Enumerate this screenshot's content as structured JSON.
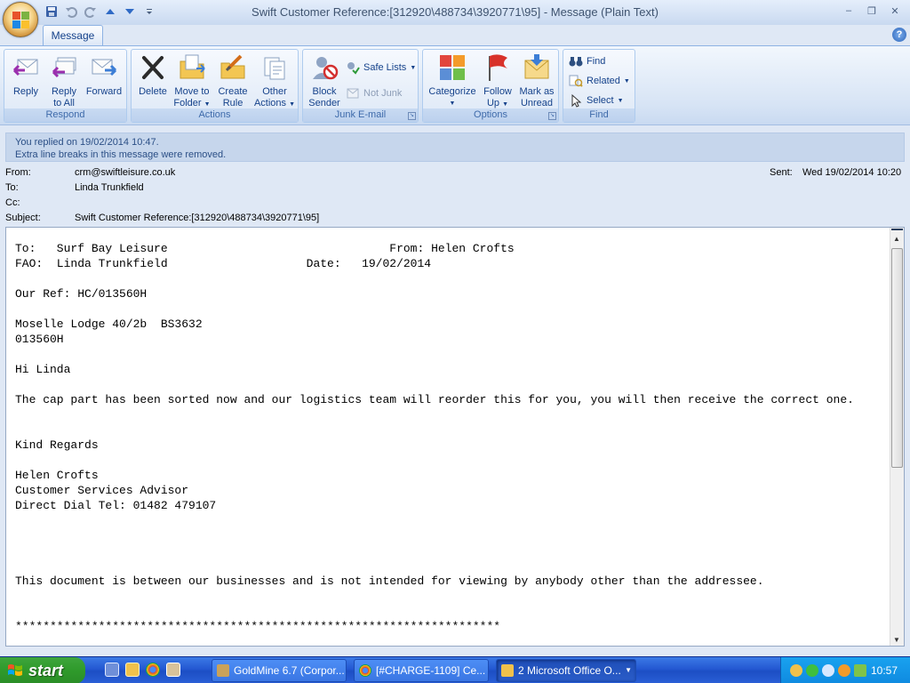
{
  "window": {
    "title": "Swift Customer Reference:[312920\\488734\\3920771\\95] - Message (Plain Text)",
    "controls": {
      "minimize": "–",
      "restore": "❐",
      "close": "✕"
    }
  },
  "ribbon": {
    "tabs": [
      {
        "label": "Message"
      }
    ],
    "help": "?",
    "respond": {
      "label": "Respond",
      "reply": "Reply",
      "reply_all_1": "Reply",
      "reply_all_2": "to All",
      "forward": "Forward"
    },
    "actions": {
      "label": "Actions",
      "delete": "Delete",
      "move_1": "Move to",
      "move_2": "Folder",
      "rule_1": "Create",
      "rule_2": "Rule",
      "other_1": "Other",
      "other_2": "Actions"
    },
    "junk": {
      "label": "Junk E-mail",
      "block_1": "Block",
      "block_2": "Sender",
      "safe_lists": "Safe Lists",
      "not_junk": "Not Junk"
    },
    "options": {
      "label": "Options",
      "categorize": "Categorize",
      "follow_1": "Follow",
      "follow_2": "Up",
      "mark_1": "Mark as",
      "mark_2": "Unread"
    },
    "find": {
      "label": "Find",
      "find": "Find",
      "related": "Related",
      "select": "Select"
    }
  },
  "infobar": {
    "line1": "You replied on 19/02/2014 10:47.",
    "line2": "Extra line breaks in this message were removed."
  },
  "headers": {
    "from_label": "From:",
    "from": "crm@swiftleisure.co.uk",
    "to_label": "To:",
    "to": "Linda Trunkfield",
    "cc_label": "Cc:",
    "cc": "",
    "subject_label": "Subject:",
    "subject": "Swift Customer Reference:[312920\\488734\\3920771\\95]",
    "sent_label": "Sent:",
    "sent": "Wed 19/02/2014 10:20"
  },
  "body": "To:   Surf Bay Leisure                                From: Helen Crofts\nFAO:  Linda Trunkfield                    Date:   19/02/2014\n\nOur Ref: HC/013560H\n\nMoselle Lodge 40/2b  BS3632\n013560H\n\nHi Linda\n\nThe cap part has been sorted now and our logistics team will reorder this for you, you will then receive the correct one.\n\n\nKind Regards\n\nHelen Crofts\nCustomer Services Advisor\nDirect Dial Tel: 01482 479107\n\n\n\n\nThis document is between our businesses and is not intended for viewing by anybody other than the addressee.\n\n\n**********************************************************************",
  "taskbar": {
    "start": "start",
    "tasks": [
      {
        "label": "GoldMine 6.7 (Corpor..."
      },
      {
        "label": "[#CHARGE-1109] Ce..."
      },
      {
        "label": "2 Microsoft Office O..."
      }
    ],
    "clock": "10:57"
  },
  "colors": {
    "ribbon_text": "#15428b",
    "taskbar": "#245edb",
    "start": "#3a9b36",
    "tray": "#0f8ae0"
  }
}
